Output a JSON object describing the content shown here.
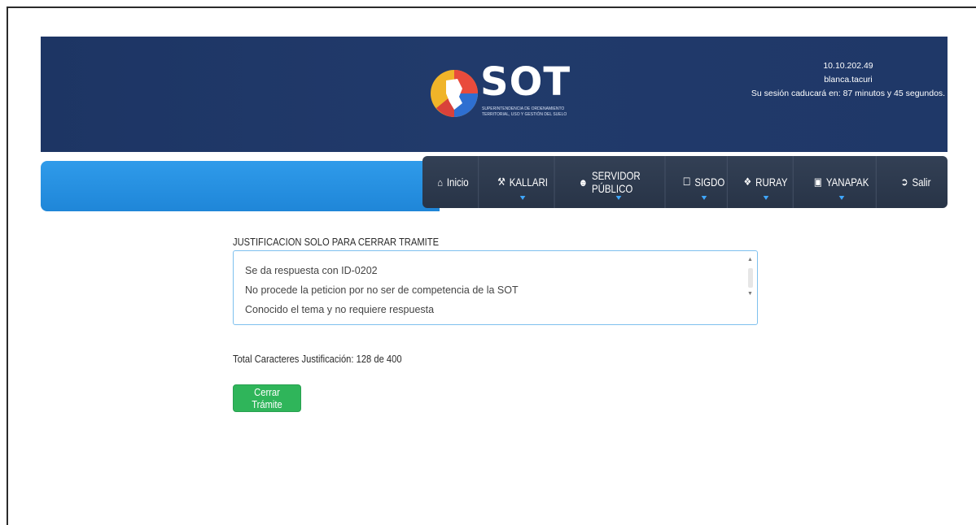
{
  "header": {
    "logo_text": "SOT",
    "logo_subtitle": "Superintendencia de Ordenamiento Territorial, Uso y Gestión del Suelo",
    "ip": "10.10.202.49",
    "user": "blanca.tacuri",
    "session_timer": "Su sesión caducará en: 87 minutos y 45 segundos."
  },
  "nav": {
    "items": [
      {
        "label": "Inicio",
        "icon": "home-icon"
      },
      {
        "label": "KALLARI",
        "icon": "gavel-icon"
      },
      {
        "label": "SERVIDOR PÚBLICO",
        "icon": "user-icon"
      },
      {
        "label": "SIGDO",
        "icon": "file-icon"
      },
      {
        "label": "RURAY",
        "icon": "tag-icon"
      },
      {
        "label": "YANAPAK",
        "icon": "briefcase-icon"
      },
      {
        "label": "Salir",
        "icon": "logout-icon"
      }
    ]
  },
  "form": {
    "justification_label": "JUSTIFICACION SOLO PARA CERRAR TRAMITE",
    "justification_value": "Se da respuesta con ID-0202\nNo procede la peticion por no ser de competencia de la SOT\nConocido el tema y no requiere respuesta",
    "char_count": "Total Caracteres Justificación: 128 de 400",
    "close_button": "Cerrar Trámite"
  },
  "colors": {
    "header_bg": "#1d3564",
    "nav_blue": "#2f9bea",
    "nav_dark": "#2d3a4e",
    "button_green": "#2fb55a"
  }
}
